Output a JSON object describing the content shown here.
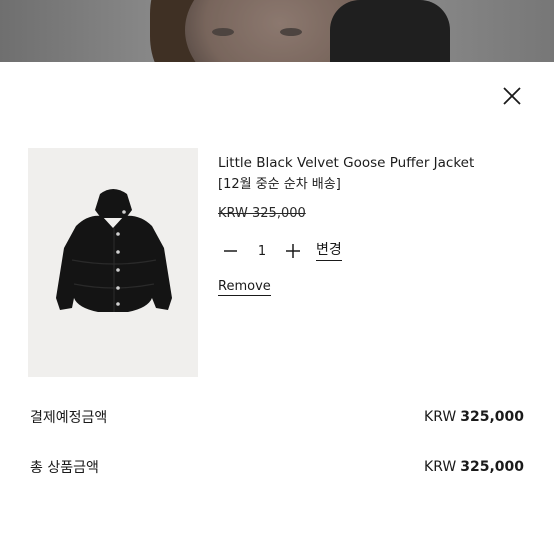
{
  "product": {
    "title": "Little Black Velvet Goose Puffer Jacket",
    "subtitle": "[12월 중순 순차 배송]",
    "old_price": "KRW 325,000",
    "quantity": "1",
    "change_label": "변경",
    "remove_label": "Remove"
  },
  "summary": {
    "rows": [
      {
        "label": "결제예정금액",
        "currency": "KRW",
        "amount": "325,000"
      },
      {
        "label": "총 상품금액",
        "currency": "KRW",
        "amount": "325,000"
      }
    ]
  },
  "icons": {
    "close": "close-icon",
    "minus": "minus-icon",
    "plus": "plus-icon"
  },
  "colors": {
    "text": "#1a1a1a",
    "thumb_bg": "#f0efed",
    "jacket": "#141414"
  }
}
